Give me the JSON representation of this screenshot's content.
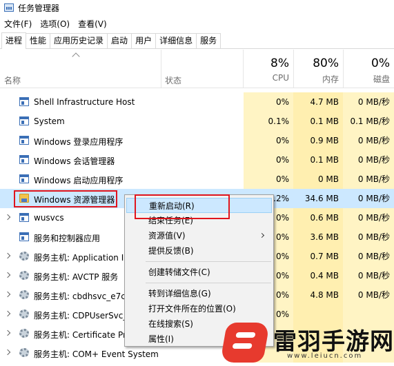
{
  "window": {
    "title": "任务管理器"
  },
  "menu": [
    "文件(F)",
    "选项(O)",
    "查看(V)"
  ],
  "tabs": [
    {
      "label": "进程",
      "active": true
    },
    {
      "label": "性能"
    },
    {
      "label": "应用历史记录"
    },
    {
      "label": "启动"
    },
    {
      "label": "用户"
    },
    {
      "label": "详细信息"
    },
    {
      "label": "服务"
    }
  ],
  "columns": {
    "name": "名称",
    "status": "状态",
    "cpu": {
      "pct": "8%",
      "label": "CPU"
    },
    "memory": {
      "pct": "80%",
      "label": "内存"
    },
    "disk": {
      "pct": "0%",
      "label": "磁盘"
    }
  },
  "processes": [
    {
      "name": "Shell Infrastructure Host",
      "icon": "window-icon",
      "cpu": "0%",
      "mem": "4.7 MB",
      "disk": "0 MB/秒"
    },
    {
      "name": "System",
      "icon": "window-icon",
      "cpu": "0.1%",
      "mem": "0.1 MB",
      "disk": "0.1 MB/秒"
    },
    {
      "name": "Windows 登录应用程序",
      "icon": "window-icon",
      "cpu": "0%",
      "mem": "0.9 MB",
      "disk": "0 MB/秒"
    },
    {
      "name": "Windows 会话管理器",
      "icon": "window-icon",
      "cpu": "0%",
      "mem": "0.1 MB",
      "disk": "0 MB/秒"
    },
    {
      "name": "Windows 启动应用程序",
      "icon": "window-icon",
      "cpu": "0%",
      "mem": "0 MB",
      "disk": "0 MB/秒"
    },
    {
      "name": "Windows 资源管理器",
      "icon": "folder-icon",
      "cpu": "0.2%",
      "mem": "34.6 MB",
      "disk": "0 MB/秒",
      "selected": true
    },
    {
      "name": "wusvcs",
      "icon": "window-icon",
      "cpu": "0%",
      "mem": "0.6 MB",
      "disk": "0 MB/秒",
      "expandable": true
    },
    {
      "name": "服务和控制器应用",
      "icon": "window-icon",
      "cpu": "0%",
      "mem": "3.6 MB",
      "disk": "0 MB/秒"
    },
    {
      "name": "服务主机: Application Ir",
      "icon": "gear-icon",
      "cpu": "0%",
      "mem": "0.7 MB",
      "disk": "0 MB/秒",
      "expandable": true
    },
    {
      "name": "服务主机: AVCTP 服务",
      "icon": "gear-icon",
      "cpu": "0%",
      "mem": "0.4 MB",
      "disk": "0 MB/秒",
      "expandable": true
    },
    {
      "name": "服务主机: cbdhsvc_e7c3",
      "icon": "gear-icon",
      "cpu": "0%",
      "mem": "4.8 MB",
      "disk": "0 MB/秒",
      "expandable": true
    },
    {
      "name": "服务主机: CDPUserSvc_",
      "icon": "gear-icon",
      "cpu": "0%",
      "mem": "",
      "disk": "",
      "expandable": true
    },
    {
      "name": "服务主机: Certificate Pr",
      "icon": "gear-icon",
      "cpu": "",
      "mem": "",
      "disk": "",
      "expandable": true
    },
    {
      "name": "服务主机: COM+ Event System",
      "icon": "gear-icon",
      "cpu": "",
      "mem": "",
      "disk": "",
      "expandable": true
    }
  ],
  "context_menu": [
    {
      "label": "重新启动(R)",
      "highlight": true
    },
    {
      "label": "结束任务(E)"
    },
    {
      "label": "资源值(V)",
      "submenu": true
    },
    {
      "label": "提供反馈(B)"
    },
    {
      "separator": true
    },
    {
      "label": "创建转储文件(C)"
    },
    {
      "separator": true
    },
    {
      "label": "转到详细信息(G)"
    },
    {
      "label": "打开文件所在的位置(O)"
    },
    {
      "label": "在线搜索(S)"
    },
    {
      "label": "属性(I)"
    }
  ],
  "watermark": {
    "text": "雷羽手游网",
    "url": "www.leiucn.com"
  },
  "colors": {
    "highlight_box": "#e0141c",
    "selection": "#cce8ff",
    "usage_bg": "#fff4c4"
  }
}
